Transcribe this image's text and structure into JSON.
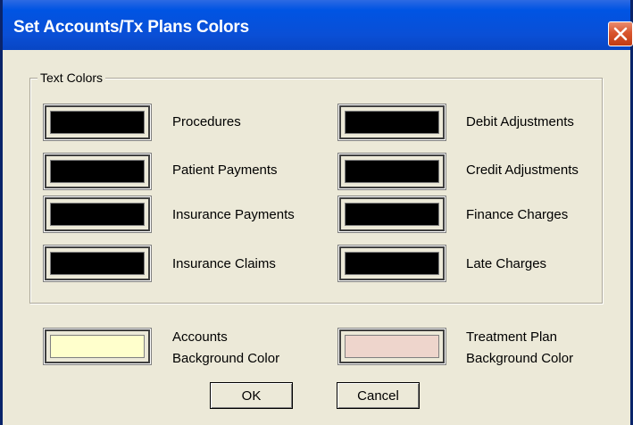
{
  "window": {
    "title": "Set Accounts/Tx Plans Colors"
  },
  "text_colors": {
    "group_label": "Text Colors",
    "items": [
      {
        "label": "Procedures",
        "color": "#000000"
      },
      {
        "label": "Patient Payments",
        "color": "#000000"
      },
      {
        "label": "Insurance Payments",
        "color": "#000000"
      },
      {
        "label": "Insurance Claims",
        "color": "#000000"
      },
      {
        "label": "Debit Adjustments",
        "color": "#000000"
      },
      {
        "label": "Credit Adjustments",
        "color": "#000000"
      },
      {
        "label": "Finance Charges",
        "color": "#000000"
      },
      {
        "label": "Late Charges",
        "color": "#000000"
      }
    ]
  },
  "backgrounds": {
    "accounts": {
      "line1": "Accounts",
      "line2": "Background Color",
      "color": "#ffffcc"
    },
    "treatment_plan": {
      "line1": "Treatment Plan",
      "line2": "Background Color",
      "color": "#eed5cc"
    }
  },
  "buttons": {
    "ok": "OK",
    "cancel": "Cancel"
  },
  "icons": {
    "close": "close-icon"
  }
}
